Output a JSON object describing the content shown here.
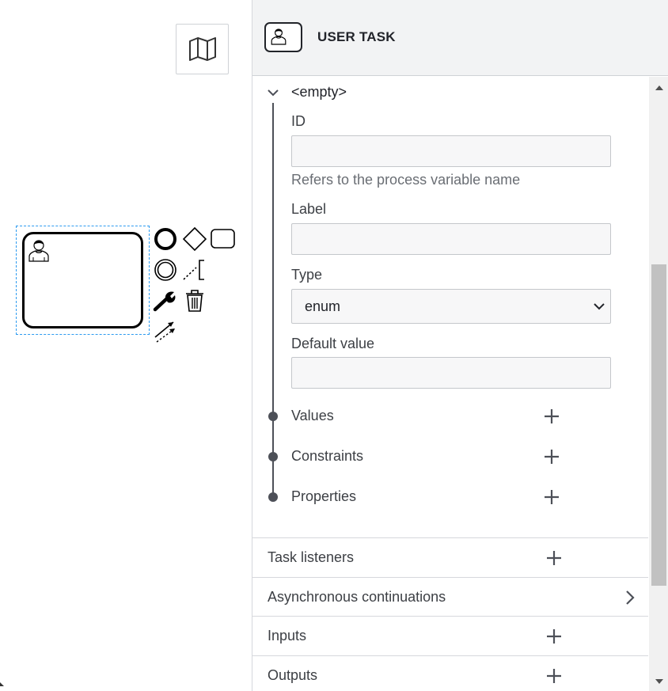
{
  "header": {
    "element_type": "USER TASK",
    "icon": "user-task-icon"
  },
  "form_field": {
    "title": "<empty>",
    "id_label": "ID",
    "id_value": "",
    "id_hint": "Refers to the process variable name",
    "label_label": "Label",
    "label_value": "",
    "type_label": "Type",
    "type_value": "enum",
    "default_label": "Default value",
    "default_value": "",
    "subsections": [
      {
        "label": "Values"
      },
      {
        "label": "Constraints"
      },
      {
        "label": "Properties"
      }
    ]
  },
  "groups": [
    {
      "label": "Task listeners",
      "icon": "plus-icon"
    },
    {
      "label": "Asynchronous continuations",
      "icon": "chevron-right-icon"
    },
    {
      "label": "Inputs",
      "icon": "plus-icon"
    },
    {
      "label": "Outputs",
      "icon": "plus-icon"
    }
  ],
  "canvas": {
    "minimap_icon": "map-icon",
    "context_pad": [
      "end-event-icon",
      "gateway-icon",
      "task-icon",
      "intermediate-event-icon",
      "text-annotation-icon",
      "wrench-icon",
      "trash-icon",
      "connect-icon"
    ]
  },
  "colors": {
    "selection": "#2d9bf0",
    "header_bg": "#f2f3f4",
    "input_bg": "#f7f7f8",
    "timeline": "#4d5058"
  }
}
